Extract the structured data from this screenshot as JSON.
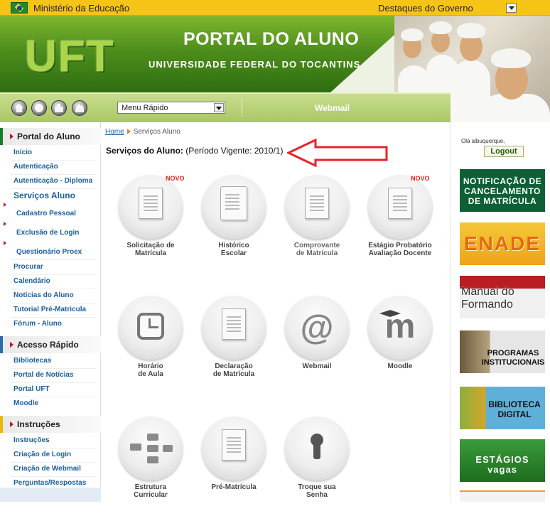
{
  "topbar": {
    "ministry": "Ministério da Educação",
    "destaques": "Destaques do Governo"
  },
  "banner": {
    "logo": "UFT",
    "title": "PORTAL DO ALUNO",
    "subtitle": "UNIVERSIDADE FEDERAL DO TOCANTINS"
  },
  "nav": {
    "icons": [
      "home-icon",
      "globe-icon",
      "sitemap-icon",
      "users-icon"
    ],
    "menu_select_value": "Menu Rápido",
    "webmail": "Webmail"
  },
  "sidebar": {
    "portal": {
      "title": "Portal do Aluno",
      "links": [
        "Início",
        "Autenticação",
        "Autenticação - Diploma"
      ],
      "active": "Serviços Aluno",
      "subs": [
        "Cadastro Pessoal",
        "Exclusão de Login",
        "Questionário Proex"
      ],
      "more": [
        "Procurar",
        "Calendário",
        "Notícias do Aluno",
        "Tutorial Pré-Matricula",
        "Fórum - Aluno"
      ]
    },
    "acesso": {
      "title": "Acesso Rápido",
      "links": [
        "Bibliotecas",
        "Portal de Notícias",
        "Portal UFT",
        "Moodle"
      ]
    },
    "instrucoes": {
      "title": "Instruções",
      "links": [
        "Instruções",
        "Criação de Login",
        "Criação de Webmail",
        "Perguntas/Respostas"
      ]
    }
  },
  "main": {
    "breadcrumb": {
      "home": "Home",
      "current": "Serviços Aluno"
    },
    "heading_bold": "Serviços do Aluno:",
    "heading_rest": " (Período Vigente: 2010/1)",
    "tiles": [
      {
        "line1": "Solicitação de",
        "line2": "Matrícula",
        "badge": "NOVO",
        "icon": "document-stamp-icon"
      },
      {
        "line1": "Histórico",
        "line2": "Escolar",
        "badge": "",
        "icon": "document-icon"
      },
      {
        "line1": "Comprovante",
        "line2": "de Matrícula",
        "badge": "",
        "icon": "document-check-icon"
      },
      {
        "line1": "Estágio Probatório",
        "line2": "Avaliação Docente",
        "badge": "NOVO",
        "icon": "evaluation-form-icon"
      },
      {
        "line1": "Horário",
        "line2": "de Aula",
        "badge": "",
        "icon": "clock-icon"
      },
      {
        "line1": "Declaração",
        "line2": "de Matrícula",
        "badge": "",
        "icon": "document-icon"
      },
      {
        "line1": "Webmail",
        "line2": "",
        "badge": "",
        "icon": "at-sign-icon",
        "glyph": "@"
      },
      {
        "line1": "Moodle",
        "line2": "",
        "badge": "",
        "icon": "moodle-icon",
        "glyph": "m"
      },
      {
        "line1": "Estrutura",
        "line2": "Curricular",
        "badge": "",
        "icon": "flowchart-icon"
      },
      {
        "line1": "Pré-Matrícula",
        "line2": "",
        "badge": "",
        "icon": "document-signature-icon"
      },
      {
        "line1": "Troque sua",
        "line2": "Senha",
        "badge": "",
        "icon": "keyhole-icon"
      }
    ]
  },
  "right": {
    "greeting": "Olá albuquerque,",
    "logout": "Logout",
    "banners": [
      {
        "text": "NOTIFICAÇÃO DE CANCELAMENTO DE MATRÍCULA",
        "bg": "#0d5f34",
        "fg": "#ffffff"
      },
      {
        "text": "ENADE",
        "bg": "#f0b21c",
        "fg": "#e46a10"
      },
      {
        "text": "Manual do Formando",
        "bg": "#b81e23",
        "fg": "#ffffff"
      },
      {
        "text": "PROGRAMAS INSTITUCIONAIS",
        "bg": "#d8d8d8",
        "fg": "#111111"
      },
      {
        "text": "BIBLIOTECA DIGITAL",
        "bg": "#5fb0d9",
        "fg": "#1a1a1a"
      },
      {
        "text": "ESTÁGIOS vagas",
        "bg": "#2e8b2e",
        "fg": "#ffffff"
      }
    ]
  },
  "colors": {
    "accent_green": "#4e8e1c",
    "link_blue": "#1a5fa0",
    "badge_red": "#e2231a",
    "arrow_red": "#e5232b"
  }
}
